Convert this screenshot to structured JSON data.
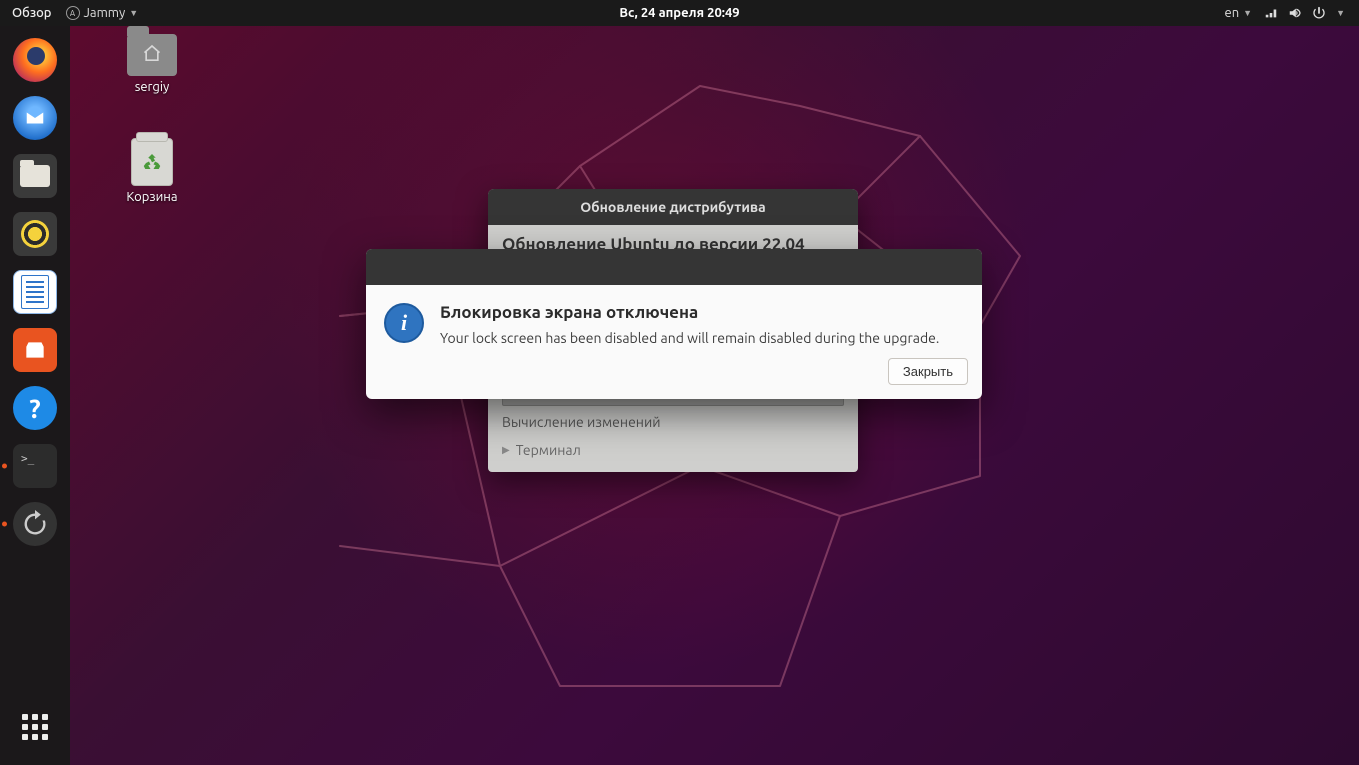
{
  "topbar": {
    "activities_label": "Обзор",
    "app_menu_label": "Jammy",
    "clock": "Вс, 24 апреля  20:49",
    "lang_indicator": "en"
  },
  "desktop_icons": {
    "home_label": "sergiy",
    "trash_label": "Корзина"
  },
  "upgrade_window": {
    "title": "Обновление дистрибутива",
    "heading": "Обновление Ubuntu до версии 22.04",
    "status": "Вычисление изменений",
    "expander_label": "Терминал"
  },
  "info_dialog": {
    "title": "Блокировка экрана отключена",
    "message": "Your lock screen has been disabled and will remain disabled during the upgrade.",
    "close_button": "Закрыть"
  },
  "dock": {
    "items": [
      "firefox",
      "thunderbird",
      "files",
      "rhythmbox",
      "libreoffice-writer",
      "ubuntu-software",
      "help",
      "terminal",
      "software-updater"
    ]
  }
}
